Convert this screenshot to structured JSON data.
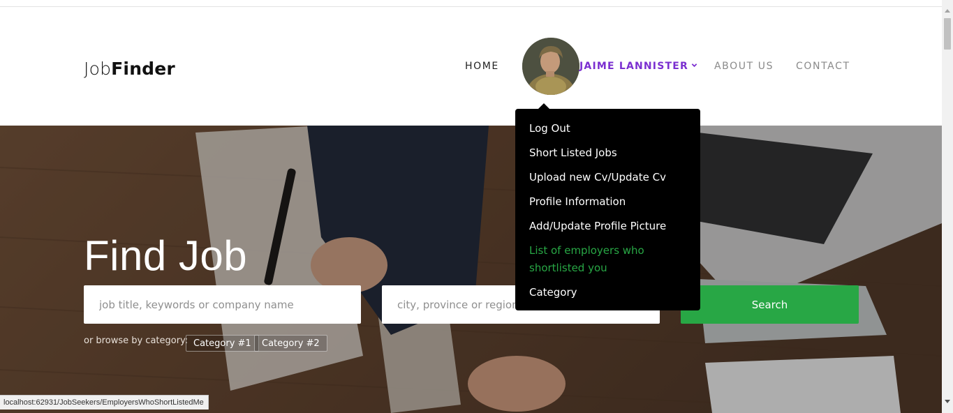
{
  "brand": {
    "light": "Job",
    "bold": "Finder"
  },
  "nav": {
    "home": "HOME",
    "user": "JAIME LANNISTER",
    "about": "ABOUT US",
    "contact": "CONTACT"
  },
  "user_menu": {
    "items": [
      {
        "label": "Log Out"
      },
      {
        "label": "Short Listed Jobs"
      },
      {
        "label": "Upload new Cv/Update Cv"
      },
      {
        "label": "Profile Information"
      },
      {
        "label": "Add/Update Profile Picture"
      },
      {
        "label": "List of employers who shortlisted you",
        "active": true
      },
      {
        "label": "Category"
      }
    ]
  },
  "hero": {
    "title": "Find Job",
    "keyword_placeholder": "job title, keywords or company name",
    "location_placeholder": "city, province or region",
    "search_label": "Search",
    "browse_label": "or browse by category:",
    "categories": [
      "Category #1",
      "Category #2"
    ]
  },
  "status_url": "localhost:62931/JobSeekers/EmployersWhoShortListedMe",
  "colors": {
    "accent_purple": "#7b2fd0",
    "accent_green": "#28a745",
    "menu_bg": "#000000"
  }
}
